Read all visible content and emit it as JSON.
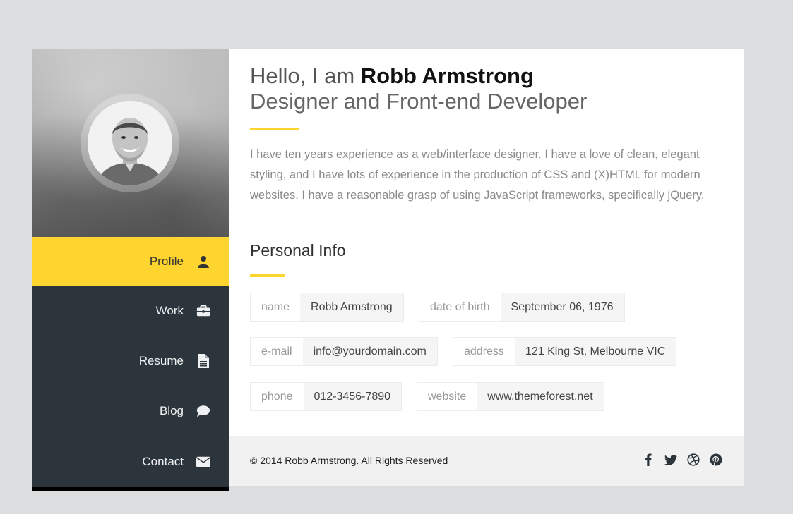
{
  "sidebar": {
    "nav": [
      {
        "label": "Profile",
        "icon": "user-icon",
        "active": true
      },
      {
        "label": "Work",
        "icon": "briefcase-icon"
      },
      {
        "label": "Resume",
        "icon": "file-icon"
      },
      {
        "label": "Blog",
        "icon": "comment-icon"
      },
      {
        "label": "Contact",
        "icon": "envelope-icon"
      }
    ]
  },
  "main": {
    "greeting_prefix": "Hello, I am ",
    "name": "Robb Armstrong",
    "subtitle": "Designer and Front-end Developer",
    "bio": "I have ten years experience as a web/interface designer. I have a love of clean, elegant styling, and I have lots of experience in the production of CSS and (X)HTML for modern websites. I have a reasonable grasp of using JavaScript frameworks, specifically jQuery.",
    "section_title": "Personal Info",
    "info": [
      {
        "key": "name",
        "value": "Robb Armstrong"
      },
      {
        "key": "date of birth",
        "value": "September 06, 1976"
      },
      {
        "key": "e-mail",
        "value": "info@yourdomain.com"
      },
      {
        "key": "address",
        "value": "121 King St, Melbourne VIC"
      },
      {
        "key": "phone",
        "value": "012-3456-7890"
      },
      {
        "key": "website",
        "value": "www.themeforest.net"
      }
    ]
  },
  "footer": {
    "copyright": "© 2014 Robb Armstrong. All Rights Reserved",
    "social": [
      "facebook-icon",
      "twitter-icon",
      "dribbble-icon",
      "pinterest-icon"
    ]
  },
  "colors": {
    "accent": "#fed42e",
    "sidebar_bg": "#2b353b",
    "page_bg": "#dcdddf"
  }
}
